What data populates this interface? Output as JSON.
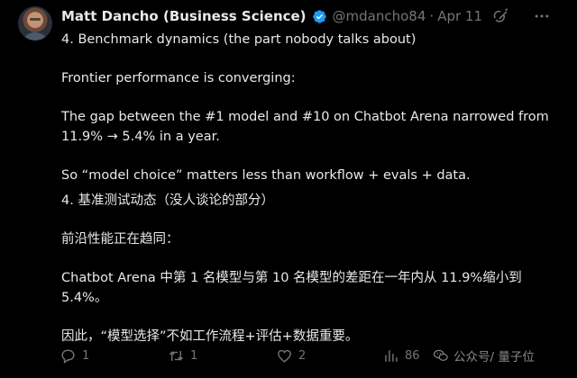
{
  "tweet": {
    "author": {
      "name": "Matt Dancho (Business Science)",
      "handle": "@mdancho84",
      "separator": "·",
      "date": "Apr 11"
    },
    "paragraphs": [
      "4. Benchmark dynamics (the part nobody talks about)",
      "Frontier performance is converging:",
      "The gap between the #1 model and #10 on Chatbot Arena narrowed from 11.9% → 5.4% in a year.",
      "So “model choice” matters less than workflow + evals + data.",
      "4. 基准测试动态（没人谈论的部分）",
      "前沿性能正在趋同：",
      "Chatbot Arena 中第 1 名模型与第 10 名模型的差距在一年内从 11.9%缩小到 5.4%。",
      "因此，“模型选择”不如工作流程+评估+数据重要。"
    ],
    "actions": {
      "reply_count": "1",
      "retweet_count": "1",
      "like_count": "2",
      "views_count": "86"
    }
  },
  "watermark": {
    "text": "公众号/ 量子位"
  },
  "colors": {
    "background": "#000000",
    "text": "#e7e9ea",
    "muted": "#71767b",
    "verified": "#1d9bf0"
  },
  "icons": [
    "verified-badge-icon",
    "grok-icon",
    "more-icon",
    "reply-icon",
    "retweet-icon",
    "like-icon",
    "views-icon",
    "wechat-icon"
  ]
}
